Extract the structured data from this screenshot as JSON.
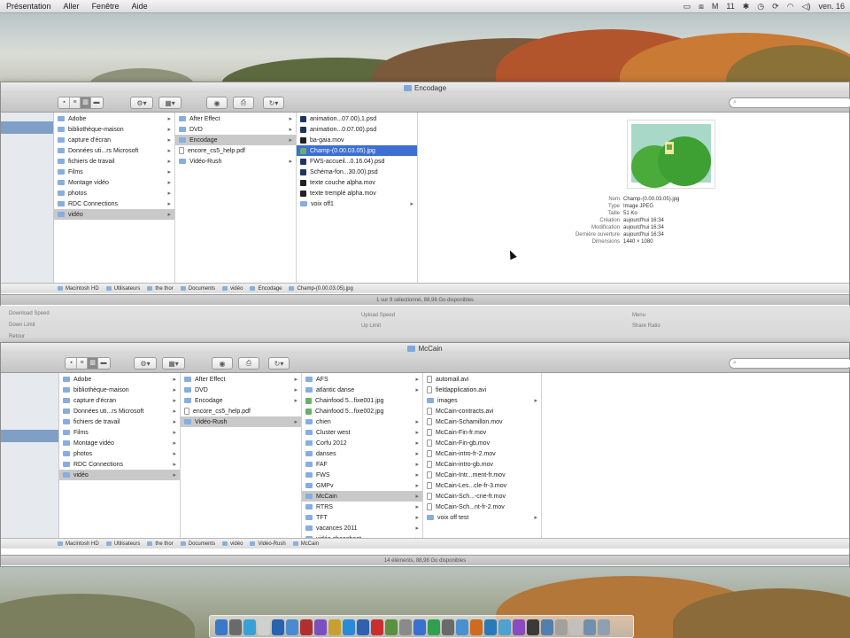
{
  "menubar": {
    "items": [
      "Présentation",
      "Aller",
      "Fenêtre",
      "Aide"
    ],
    "right": [
      "M",
      "11",
      "ven. 16"
    ]
  },
  "top_window": {
    "title": "Encodage",
    "sidebar_selected_index": 1,
    "columns": [
      {
        "items": [
          {
            "label": "Adobe",
            "folder": true
          },
          {
            "label": "bibliothèque-maison",
            "folder": true
          },
          {
            "label": "capture d'écran",
            "folder": true
          },
          {
            "label": "Données uti...rs Microsoft",
            "folder": true
          },
          {
            "label": "fichiers de travail",
            "folder": true
          },
          {
            "label": "Films",
            "folder": true
          },
          {
            "label": "Montage vidéo",
            "folder": true
          },
          {
            "label": "photos",
            "folder": true
          },
          {
            "label": "RDC Connections",
            "folder": true
          },
          {
            "label": "vidéo",
            "folder": true,
            "selected": true
          }
        ]
      },
      {
        "items": [
          {
            "label": "After Effect",
            "folder": true
          },
          {
            "label": "DVD",
            "folder": true
          },
          {
            "label": "Encodage",
            "folder": true,
            "selected": true
          },
          {
            "label": "encore_cs5_help.pdf",
            "folder": false,
            "kind": "doc"
          },
          {
            "label": "Vidéo-Rush",
            "folder": true
          }
        ]
      },
      {
        "items": [
          {
            "label": "animation...07.00),1.psd",
            "kind": "psd"
          },
          {
            "label": "animation...0.07.00).psd",
            "kind": "psd"
          },
          {
            "label": "ba-gaia.mov",
            "kind": "mov"
          },
          {
            "label": "Champ-(0.00.03.05).jpg",
            "kind": "img",
            "selectedBlue": true
          },
          {
            "label": "FWS-accueil...0.16.04).psd",
            "kind": "psd"
          },
          {
            "label": "Schéma-fon...30.00).psd",
            "kind": "psd"
          },
          {
            "label": "texte couche alpha.mov",
            "kind": "mov"
          },
          {
            "label": "texte tremplé alpha.mov",
            "kind": "mov"
          },
          {
            "label": "voix off1",
            "folder": true
          }
        ]
      }
    ],
    "preview": {
      "info": [
        {
          "k": "Nom",
          "v": "Champ-(0.00.03.05).jpg"
        },
        {
          "k": "Type",
          "v": "Image JPEG"
        },
        {
          "k": "Taille",
          "v": "51 Ko"
        },
        {
          "k": "Création",
          "v": "aujourd'hui 16:34"
        },
        {
          "k": "Modification",
          "v": "aujourd'hui 16:34"
        },
        {
          "k": "Dernière ouverture",
          "v": "aujourd'hui 16:34"
        },
        {
          "k": "Dimensions",
          "v": "1440 × 1080"
        }
      ]
    },
    "path": [
      "Macintosh HD",
      "Utilisateurs",
      "the thor",
      "Documents",
      "vidéo",
      "Encodage",
      "Champ-(0.00.03.05).jpg"
    ],
    "status": "1 sur 9 sélectionné, 88,98 Go disponibles"
  },
  "midband": {
    "labels": [
      "Download Speed",
      "Down Limit",
      "Retour",
      "Upload Speed",
      "Up Limit",
      "Menu",
      "Share Ratio"
    ]
  },
  "bottom_window": {
    "title": "McCain",
    "sidebar_selected_index": 1,
    "columns": [
      {
        "items": [
          {
            "label": "Adobe",
            "folder": true
          },
          {
            "label": "bibliothèque-maison",
            "folder": true
          },
          {
            "label": "capture d'écran",
            "folder": true
          },
          {
            "label": "Données uti...rs Microsoft",
            "folder": true
          },
          {
            "label": "fichiers de travail",
            "folder": true
          },
          {
            "label": "Films",
            "folder": true
          },
          {
            "label": "Montage vidéo",
            "folder": true
          },
          {
            "label": "photos",
            "folder": true
          },
          {
            "label": "RDC Connections",
            "folder": true
          },
          {
            "label": "vidéo",
            "folder": true,
            "selected": true
          }
        ]
      },
      {
        "items": [
          {
            "label": "After Effect",
            "folder": true
          },
          {
            "label": "DVD",
            "folder": true
          },
          {
            "label": "Encodage",
            "folder": true
          },
          {
            "label": "encore_cs5_help.pdf",
            "kind": "doc"
          },
          {
            "label": "Vidéo-Rush",
            "folder": true,
            "selected": true
          }
        ]
      },
      {
        "items": [
          {
            "label": "AFS",
            "folder": true
          },
          {
            "label": "atlantic danse",
            "folder": true
          },
          {
            "label": "Chainfood 5...fixe001.jpg",
            "kind": "img"
          },
          {
            "label": "Chainfood 5...fixe002.jpg",
            "kind": "img"
          },
          {
            "label": "chien",
            "folder": true
          },
          {
            "label": "Cluster west",
            "folder": true
          },
          {
            "label": "Corfu 2012",
            "folder": true
          },
          {
            "label": "danses",
            "folder": true
          },
          {
            "label": "FAF",
            "folder": true
          },
          {
            "label": "FWS",
            "folder": true
          },
          {
            "label": "GMPv",
            "folder": true
          },
          {
            "label": "McCain",
            "folder": true,
            "selected": true
          },
          {
            "label": "RTRS",
            "folder": true
          },
          {
            "label": "TFT",
            "folder": true
          },
          {
            "label": "vacances 2011",
            "folder": true
          },
          {
            "label": "vidéo chaoshoot",
            "folder": true
          }
        ]
      },
      {
        "items": [
          {
            "label": "automail.avi",
            "kind": "doc"
          },
          {
            "label": "fieldapplication.avi",
            "kind": "doc"
          },
          {
            "label": "images",
            "folder": true
          },
          {
            "label": "McCain-contracts.avi",
            "kind": "doc"
          },
          {
            "label": "McCain-Schamillon.mov",
            "kind": "doc"
          },
          {
            "label": "McCain-Fin-fr.mov",
            "kind": "doc"
          },
          {
            "label": "McCain-Fin-gb.mov",
            "kind": "doc"
          },
          {
            "label": "McCain-intro-fr-2.mov",
            "kind": "doc"
          },
          {
            "label": "McCain-intro-gb.mov",
            "kind": "doc"
          },
          {
            "label": "McCain-Intr...ment-fr.mov",
            "kind": "doc"
          },
          {
            "label": "McCain-Les...cle-fr-3.mov",
            "kind": "doc"
          },
          {
            "label": "McCain-Sch...-cne-fr.mov",
            "kind": "doc"
          },
          {
            "label": "McCain-Sch...nt-fr-2.mov",
            "kind": "doc"
          },
          {
            "label": "voix off test",
            "folder": true
          }
        ]
      }
    ],
    "path": [
      "Macintosh HD",
      "Utilisateurs",
      "the thor",
      "Documents",
      "vidéo",
      "Vidéo-Rush",
      "McCain"
    ],
    "status": "14 éléments, 88,98 Go disponibles"
  },
  "dock": {
    "count": 28
  }
}
